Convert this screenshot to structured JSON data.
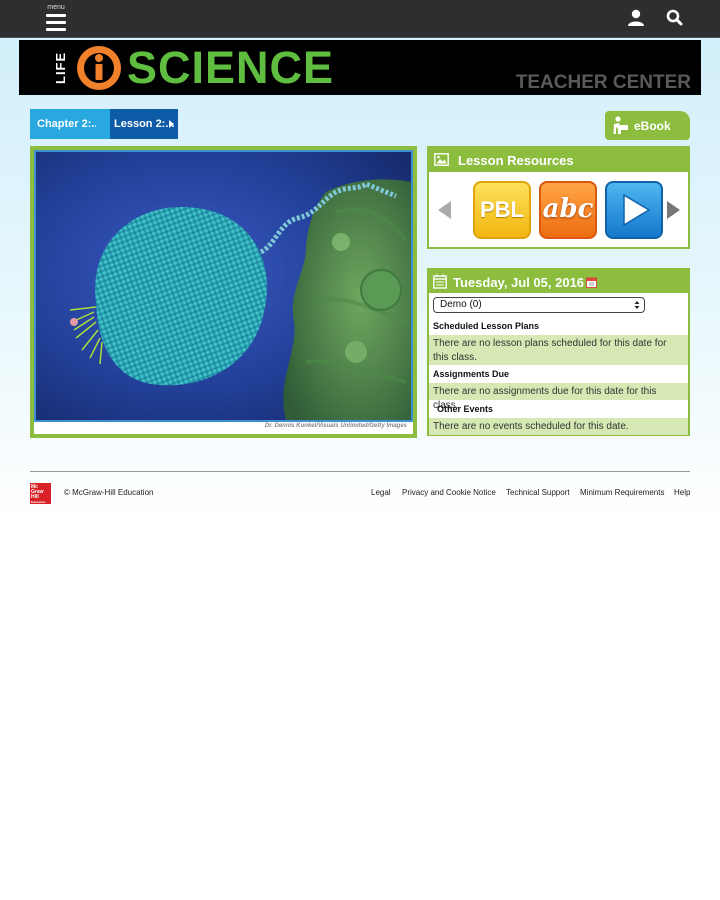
{
  "topbar": {
    "menu_label": "menu",
    "menu_icon": "hamburger-icon",
    "user_icon": "user-icon",
    "search_icon": "search-icon"
  },
  "banner": {
    "life": "LIFE",
    "logo_letter": "i",
    "science": "SCIENCE",
    "subtitle": "TEACHER CENTER"
  },
  "breadcrumb": {
    "chapter": "Chapter 2:...",
    "lesson": "Lesson 2:..."
  },
  "ebook": {
    "label": "eBook",
    "icon": "reader-icon"
  },
  "hero": {
    "caption": "Dr. Dennis Kunkel/Visuals Unlimited/Getty Images"
  },
  "resources": {
    "title": "Lesson Resources",
    "icon": "image-icon",
    "tiles": [
      {
        "label": "PBL",
        "icon": "pbl-icon"
      },
      {
        "label": "abc",
        "icon": "vocabulary-icon"
      },
      {
        "label": "",
        "icon": "play-icon"
      }
    ]
  },
  "calendar": {
    "date": "Tuesday, Jul 05, 2016",
    "icon": "calendar-icon",
    "selected_class": "Demo (0)",
    "sections": [
      {
        "title": "Scheduled Lesson Plans",
        "message": "There are no lesson plans scheduled for this date for this class."
      },
      {
        "title": "Assignments Due",
        "message": "There are no assignments due for this date for this class."
      },
      {
        "title": "Other Events",
        "message": "There are no events scheduled for this date."
      }
    ]
  },
  "footer": {
    "logo_lines": [
      "Mc",
      "Graw",
      "Hill",
      "Education"
    ],
    "copyright": "© McGraw-Hill Education",
    "links": [
      "Legal",
      "Privacy and Cookie Notice",
      "Technical Support",
      "Minimum Requirements",
      "Help"
    ]
  },
  "colors": {
    "accent_green": "#8cbd3f",
    "breadcrumb_light": "#29a8e0",
    "breadcrumb_dark": "#0d5aa6",
    "topbar": "#2e2e30",
    "message_bg": "#d6e8b3"
  }
}
